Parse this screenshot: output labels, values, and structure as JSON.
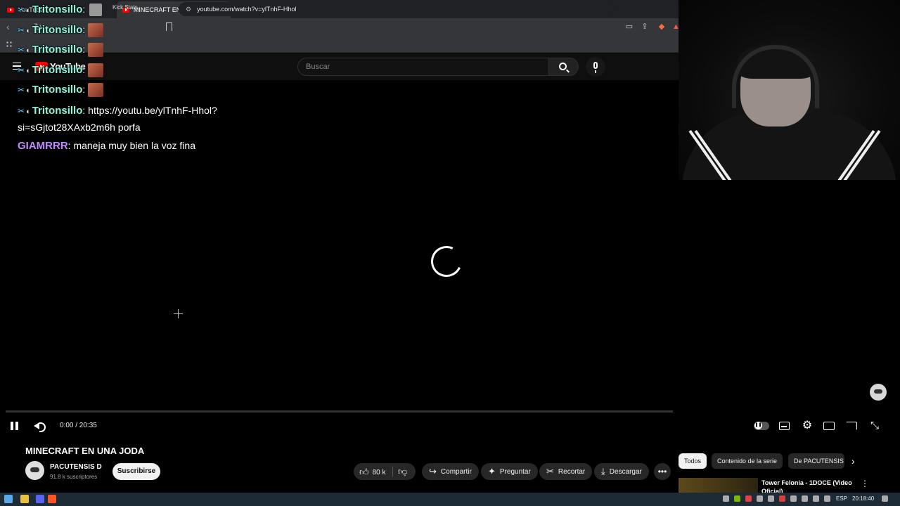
{
  "browser": {
    "tabs": [
      {
        "label": "YouTube",
        "active": false
      },
      {
        "label": "MINECRAFT EN UNA JODA - You",
        "active": true
      }
    ],
    "url": "youtube.com/watch?v=ylTnhF-Hhol",
    "bookmarks": [
      "Kick Stats"
    ]
  },
  "youtube": {
    "logo_text": "YouTube",
    "search_placeholder": "Buscar"
  },
  "chat": {
    "messages": [
      {
        "user": "Tritonsillo",
        "text": ":"
      },
      {
        "user": "Tritonsillo",
        "text": ":"
      },
      {
        "user": "Tritonsillo",
        "text": ":"
      },
      {
        "user": "Tritonsillo",
        "text": ":"
      },
      {
        "user": "Tritonsillo",
        "text": ":"
      },
      {
        "user": "Tritonsillo",
        "text": ": https://youtu.be/ylTnhF-Hhol?si=sGjtot28XAxb2m6h porfa"
      },
      {
        "user": "GIAMRRR",
        "text": ": maneja muy bien la voz fina"
      }
    ]
  },
  "player": {
    "time": "0:00 / 20:35",
    "progress": 0
  },
  "video": {
    "title": "MINECRAFT EN UNA JODA",
    "channel": "PACUTENSIS D",
    "subscribers": "91.8 k suscriptores",
    "subscribe_label": "Suscribirse",
    "likes": "80 k",
    "share_label": "Compartir",
    "ask_label": "Preguntar",
    "clip_label": "Recortar",
    "download_label": "Descargar"
  },
  "sidebar": {
    "chips": [
      "Todos",
      "Contenido de la serie",
      "De PACUTENSIS"
    ],
    "recommendation_title": "Tower Felonia - 1DOCE (Video Oficial)"
  },
  "taskbar": {
    "language": "ESP",
    "clock": "20:18:40"
  },
  "colors": {
    "youtube_red": "#ff0000",
    "chat_user": "#8cf5dc",
    "chat_user_alt": "#c08cff"
  }
}
